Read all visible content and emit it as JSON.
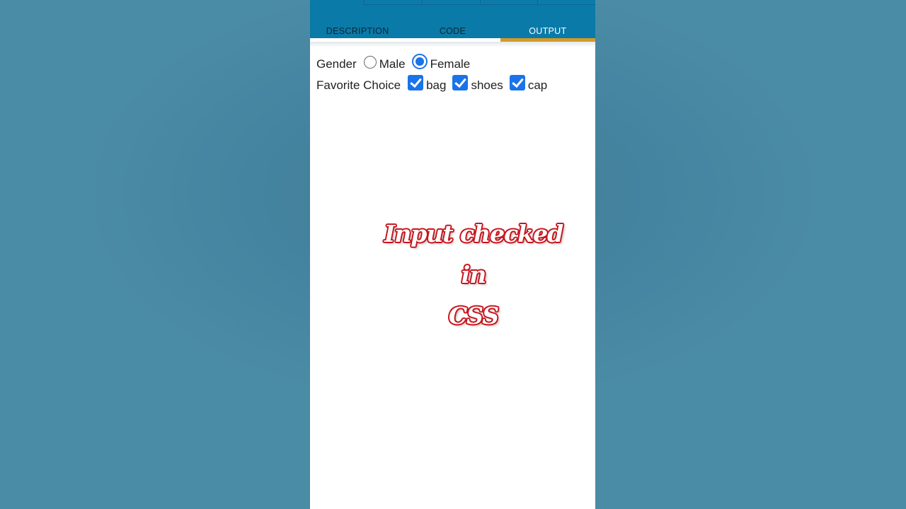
{
  "tabs": [
    {
      "label": "DESCRIPTION",
      "active": false
    },
    {
      "label": "CODE",
      "active": false
    },
    {
      "label": "OUTPUT",
      "active": true
    }
  ],
  "form": {
    "gender": {
      "label": "Gender",
      "options": [
        {
          "label": "Male",
          "checked": false
        },
        {
          "label": "Female",
          "checked": true
        }
      ]
    },
    "favorite": {
      "label": "Favorite Choice",
      "options": [
        {
          "label": "bag",
          "checked": true
        },
        {
          "label": "shoes",
          "checked": true
        },
        {
          "label": "cap",
          "checked": true
        }
      ]
    }
  },
  "overlay": {
    "line1": "Input checked in",
    "line2": "CSS"
  },
  "colors": {
    "header": "#0a7aa8",
    "active_tab_indicator": "#d39a2a",
    "control_accent": "#1a73e8",
    "overlay_outline": "#c8151d",
    "backdrop": "#4a8aa3"
  }
}
